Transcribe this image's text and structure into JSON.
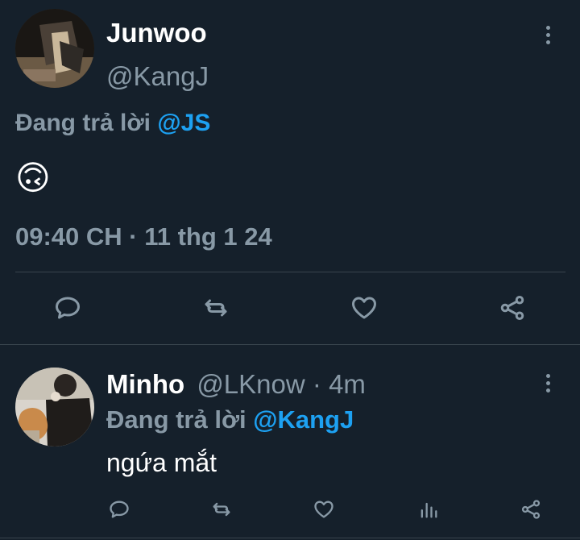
{
  "main_tweet": {
    "display_name": "Junwoo",
    "handle": "@KangJ",
    "reply_prefix": "Đang trả lời",
    "reply_to": "@JS",
    "content": "🙃",
    "timestamp": "09:40 CH · 11 thg 1 24"
  },
  "reply_tweet": {
    "display_name": "Minho",
    "handle": "@LKnow",
    "separator": "·",
    "time_ago": "4m",
    "reply_prefix": "Đang trả lời",
    "reply_to": "@KangJ",
    "content": "ngứa mắt"
  },
  "colors": {
    "background": "#15202b",
    "accent": "#1da1f2",
    "muted": "#8899a6",
    "divider": "#38444d"
  },
  "icons": [
    "more-vertical-icon",
    "reply-icon",
    "retweet-icon",
    "like-icon",
    "share-icon",
    "analytics-icon"
  ]
}
